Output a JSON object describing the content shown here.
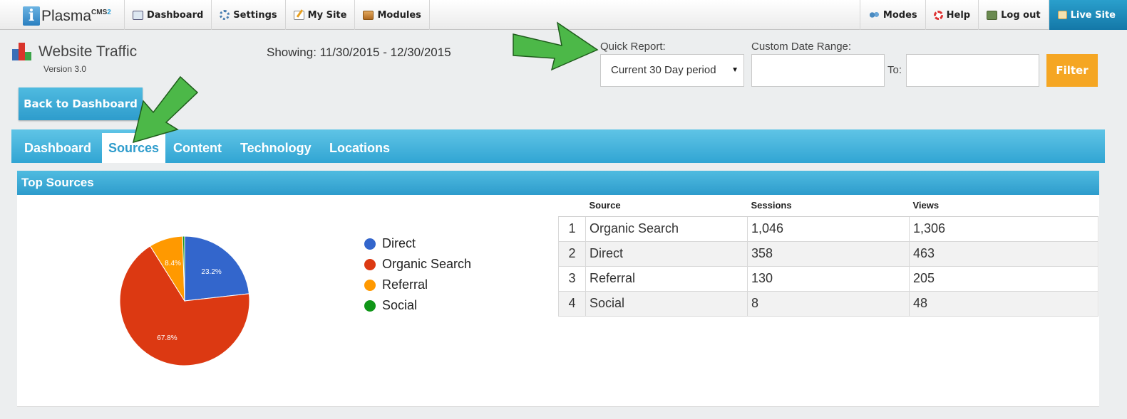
{
  "topbar": {
    "logo_text": "Plasma",
    "logo_sup": "CMS",
    "logo_sup_num": "2",
    "left_items": [
      {
        "label": "Dashboard",
        "icon": "dashboard-icon"
      },
      {
        "label": "Settings",
        "icon": "gear-icon"
      },
      {
        "label": "My Site",
        "icon": "pencil-icon"
      },
      {
        "label": "Modules",
        "icon": "modules-icon"
      }
    ],
    "right_items": [
      {
        "label": "Modes",
        "icon": "modes-icon"
      },
      {
        "label": "Help",
        "icon": "help-icon"
      },
      {
        "label": "Log out",
        "icon": "logout-icon"
      },
      {
        "label": "Live Site",
        "icon": "home-icon"
      }
    ]
  },
  "header": {
    "title": "Website Traffic",
    "version": "Version 3.0",
    "showing": "Showing: 11/30/2015 - 12/30/2015"
  },
  "report": {
    "quick_label": "Quick Report:",
    "quick_value": "Current 30 Day period",
    "custom_label": "Custom Date Range:",
    "to_label": "To:",
    "from_value": "",
    "to_value": "",
    "filter_label": "Filter"
  },
  "back_label": "Back to Dashboard",
  "tabs": [
    "Dashboard",
    "Sources",
    "Content",
    "Technology",
    "Locations"
  ],
  "active_tab": "Sources",
  "panel": {
    "title": "Top Sources"
  },
  "chart_data": {
    "type": "pie",
    "title": "",
    "slices": [
      {
        "label": "Direct",
        "value": 23.2,
        "color": "#3366cc",
        "label_text": "23.2%"
      },
      {
        "label": "Organic Search",
        "value": 67.8,
        "color": "#dc3912",
        "label_text": "67.8%"
      },
      {
        "label": "Referral",
        "value": 8.4,
        "color": "#ff9900",
        "label_text": "8.4%"
      },
      {
        "label": "Social",
        "value": 0.5,
        "color": "#109618",
        "label_text": ""
      }
    ],
    "legend_position": "right"
  },
  "table": {
    "headers": [
      "",
      "Source",
      "Sessions",
      "Views"
    ],
    "rows": [
      [
        "1",
        "Organic Search",
        "1,046",
        "1,306"
      ],
      [
        "2",
        "Direct",
        "358",
        "463"
      ],
      [
        "3",
        "Referral",
        "130",
        "205"
      ],
      [
        "4",
        "Social",
        "8",
        "48"
      ]
    ]
  },
  "colors": {
    "accent": "#2e9ccc",
    "filter": "#f5a623",
    "annotation_arrow": "#4cb848"
  }
}
